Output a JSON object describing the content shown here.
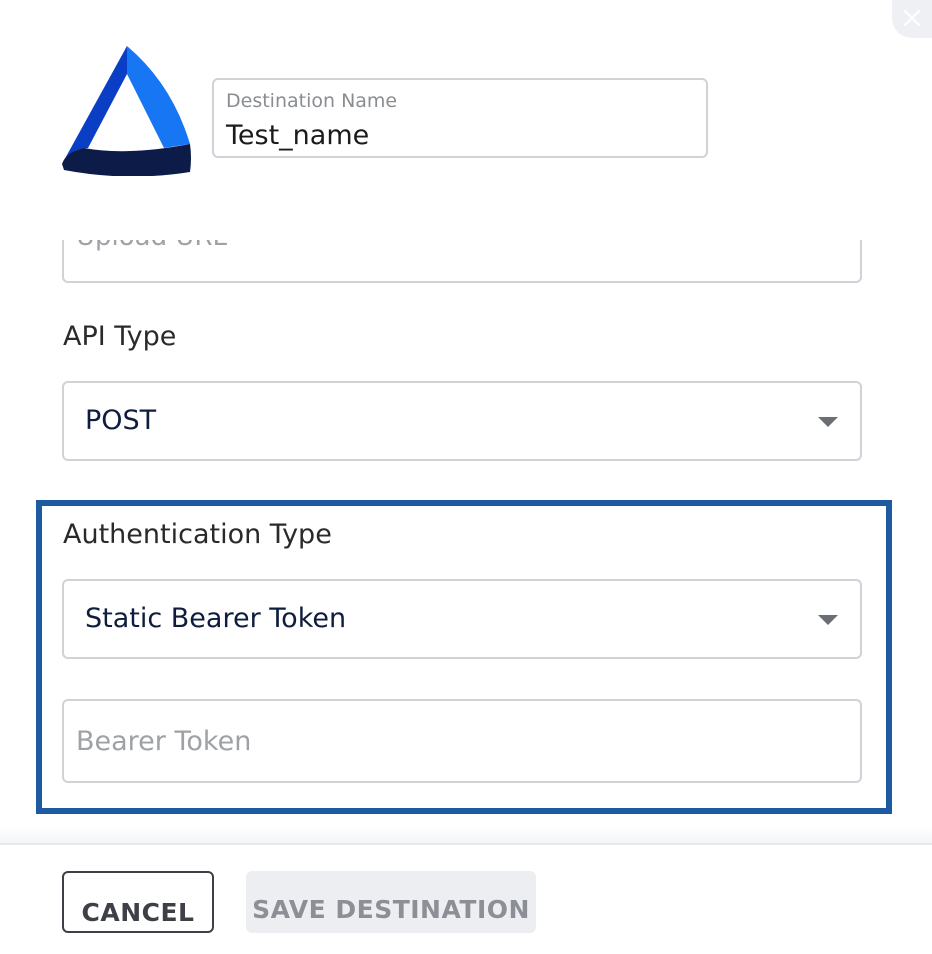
{
  "form": {
    "destination_name": {
      "label": "Destination Name",
      "value": "Test_name"
    },
    "upload_url": {
      "placeholder": "Upload URL"
    },
    "api_type": {
      "label": "API Type",
      "selected": "POST"
    },
    "authentication": {
      "label": "Authentication Type",
      "selected": "Static Bearer Token",
      "bearer_token_placeholder": "Bearer Token"
    }
  },
  "footer": {
    "cancel_label": "CANCEL",
    "save_label": "SAVE DESTINATION"
  },
  "colors": {
    "highlight_border": "#1e5aa0",
    "logo_light": "#1676f3",
    "logo_mid": "#0a3ec4",
    "logo_dark": "#0c1b47"
  },
  "icons": {
    "close": "close-icon",
    "dropdown": "chevron-down-icon"
  }
}
